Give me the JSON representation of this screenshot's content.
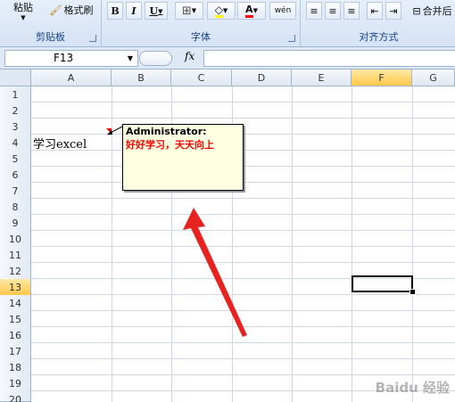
{
  "ribbon": {
    "clipboard": {
      "paste_label": "粘贴",
      "format_painter_label": "格式刷",
      "group_label": "剪贴板"
    },
    "font": {
      "bold": "B",
      "italic": "I",
      "underline": "U",
      "font_color_glyph": "A",
      "phonetic_glyph": "wén",
      "group_label": "字体",
      "highlight_color": "#ffff00",
      "font_color": "#ff0000"
    },
    "alignment": {
      "merge_label": "合并后",
      "group_label": "对齐方式"
    }
  },
  "formula_bar": {
    "name_box": "F13",
    "fx": "fx",
    "value": ""
  },
  "sheet": {
    "columns": [
      "A",
      "B",
      "C",
      "D",
      "E",
      "F",
      "G"
    ],
    "rows": [
      "1",
      "2",
      "3",
      "4",
      "5",
      "6",
      "7",
      "8",
      "9",
      "10",
      "11",
      "12",
      "13",
      "14",
      "15",
      "16",
      "17",
      "18",
      "19",
      "20"
    ],
    "selected_cell": "F13",
    "cells": {
      "A4": "学习excel"
    }
  },
  "comment": {
    "author": "Administrator:",
    "text": "好好学习，天天向上",
    "text_color": "#ff0000"
  },
  "watermark": "Baidu 经验"
}
